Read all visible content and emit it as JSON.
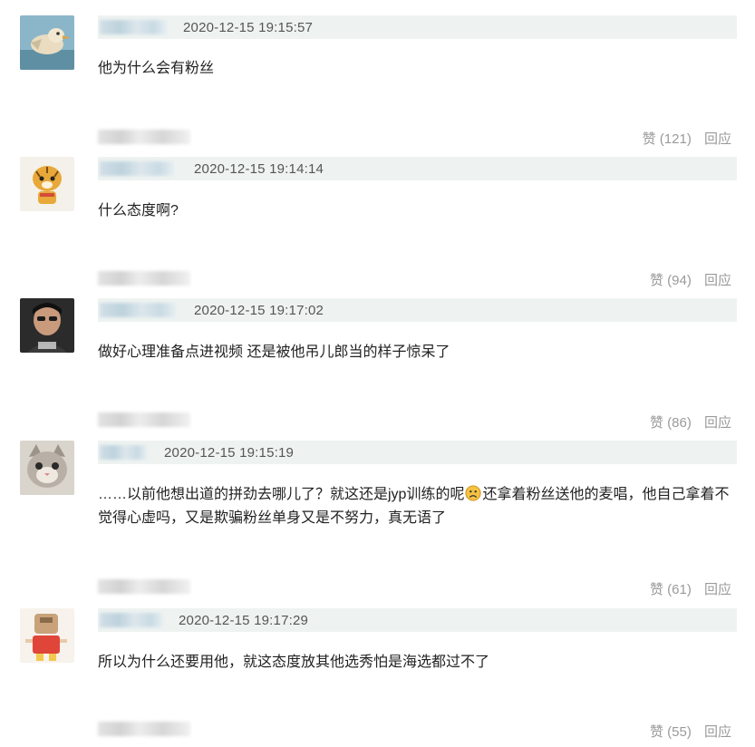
{
  "comments": [
    {
      "timestamp": "2020-12-15 19:15:57",
      "text": "他为什么会有粉丝",
      "likes_label": "赞 (121)",
      "reply_label": "回应"
    },
    {
      "timestamp": "2020-12-15 19:14:14",
      "text": "什么态度啊?",
      "likes_label": "赞 (94)",
      "reply_label": "回应"
    },
    {
      "timestamp": "2020-12-15 19:17:02",
      "text": "做好心理准备点进视频 还是被他吊儿郎当的样子惊呆了",
      "likes_label": "赞 (86)",
      "reply_label": "回应"
    },
    {
      "timestamp": "2020-12-15 19:15:19",
      "text_before_emoji": "……以前他想出道的拼劲去哪儿了？就这还是jyp训练的呢",
      "emoji": "sad-face-emoji",
      "text_after_emoji": "还拿着粉丝送他的麦唱，他自己拿着不觉得心虚吗，又是欺骗粉丝单身又是不努力，真无语了",
      "likes_label": "赞 (61)",
      "reply_label": "回应"
    },
    {
      "timestamp": "2020-12-15 19:17:29",
      "text": "所以为什么还要用他，就这态度放其他选秀怕是海选都过不了",
      "likes_label": "赞 (55)",
      "reply_label": "回应"
    }
  ],
  "colors": {
    "meta_bar": "#eef3f1",
    "timestamp": "#555555",
    "action_text": "#9a9a9a",
    "body_text": "#222222"
  }
}
